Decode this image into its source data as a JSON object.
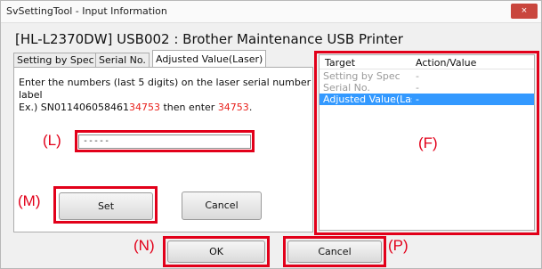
{
  "window": {
    "title": "SvSettingTool - Input Information",
    "close_glyph": "×"
  },
  "device_line": "[HL-L2370DW] USB002 : Brother Maintenance USB Printer",
  "tabs": [
    {
      "label": "Setting by Spec"
    },
    {
      "label": "Serial No."
    },
    {
      "label": "Adjusted Value(Laser)",
      "active": true
    }
  ],
  "instructions": {
    "line1": "Enter the numbers (last 5 digits) on the laser serial number label",
    "line2_prefix": "Ex.) SN011406058461",
    "line2_red": "34753",
    "line2_mid": " then enter ",
    "line2_red2": "34753",
    "line2_end": "."
  },
  "input": {
    "value": "-----"
  },
  "buttons": {
    "set": "Set",
    "cancel_inner": "Cancel",
    "ok": "OK",
    "cancel": "Cancel"
  },
  "list": {
    "headers": [
      "Target",
      "Action/Value"
    ],
    "rows": [
      {
        "target": "Setting by Spec",
        "value": "-"
      },
      {
        "target": "Serial No.",
        "value": "-"
      },
      {
        "target": "Adjusted Value(Las...",
        "value": "-",
        "selected": true
      }
    ]
  },
  "callouts": {
    "L": "(L)",
    "M": "(M)",
    "N": "(N)",
    "P": "(P)",
    "F": "(F)"
  },
  "colors": {
    "callout_red": "#e2001a",
    "selection_blue": "#3399ff",
    "example_red": "#e8201b"
  }
}
